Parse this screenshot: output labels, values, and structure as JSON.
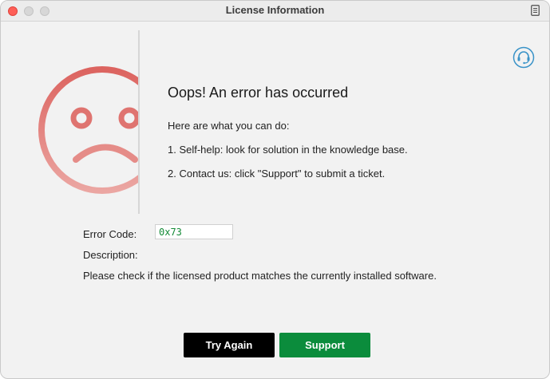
{
  "window": {
    "title": "License Information"
  },
  "message": {
    "heading": "Oops! An error has occurred",
    "intro": "Here are what you can do:",
    "step1": "1. Self-help: look for solution in the knowledge base.",
    "step2": "2. Contact us: click \"Support\" to submit a ticket."
  },
  "details": {
    "error_code_label": "Error Code:",
    "error_code_value": "0x73",
    "description_label": "Description:",
    "description_text": "Please check if the licensed product matches the currently installed software."
  },
  "buttons": {
    "try_again": "Try Again",
    "support": "Support"
  },
  "icons": {
    "face": "sad-face-icon",
    "help": "headset-support-icon",
    "menu": "document-icon"
  },
  "colors": {
    "face_accent": "#e0706b",
    "support_button": "#0b8c3c",
    "try_button": "#000000",
    "error_code_text": "#138a36",
    "help_icon": "#3a93c8"
  }
}
